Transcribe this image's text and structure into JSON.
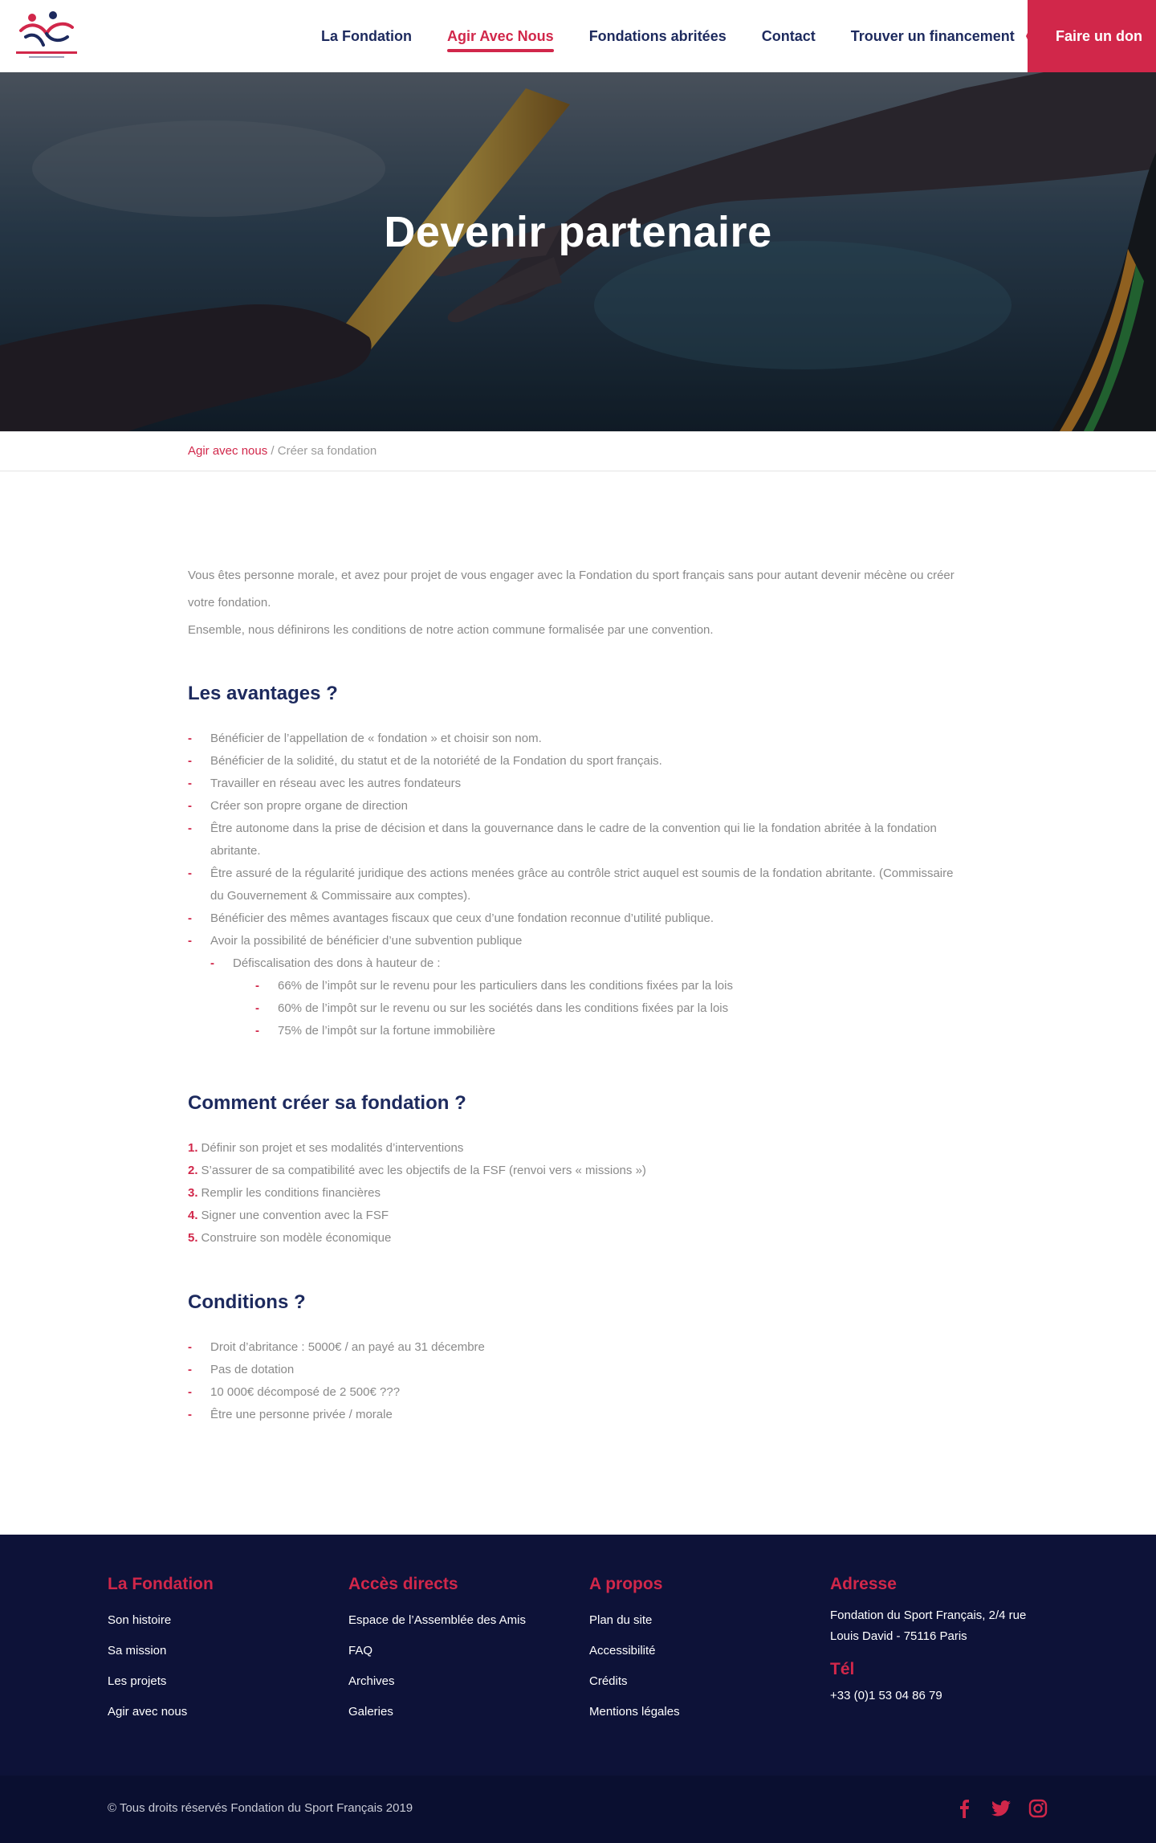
{
  "header": {
    "logo_text": "FONDATION DU SPORT FRANÇAIS",
    "nav": [
      {
        "label": "La Fondation"
      },
      {
        "label": "Agir Avec Nous"
      },
      {
        "label": "Fondations abritées"
      },
      {
        "label": "Contact"
      },
      {
        "label": "Trouver un financement"
      }
    ],
    "donate": "Faire un don"
  },
  "hero": {
    "title": "Devenir partenaire"
  },
  "breadcrumb": {
    "parent": "Agir avec nous",
    "separator": "/",
    "current": "Créer sa fondation"
  },
  "intro": [
    "Vous êtes personne morale, et avez pour projet de vous engager avec la Fondation du sport français sans pour autant devenir mécène ou créer votre fondation.",
    "Ensemble, nous définirons les conditions de notre action commune formalisée par une convention."
  ],
  "avantages": {
    "title": "Les avantages ?",
    "items": [
      "Bénéficier de l’appellation de « fondation » et choisir son nom.",
      "Bénéficier de la solidité, du statut et de la notoriété de la Fondation du sport français.",
      "Travailler en réseau avec les autres fondateurs",
      "Créer son propre organe de direction",
      "Être autonome dans la prise de décision et dans la gouvernance dans le cadre de la convention qui lie la fondation abritée à la fondation abritante.",
      "Être assuré de la régularité juridique des actions menées grâce au contrôle strict auquel est soumis de la fondation abritante. (Commissaire du Gouvernement & Commissaire aux comptes).",
      "Bénéficier des mêmes avantages fiscaux que ceux d’une fondation reconnue d’utilité publique.",
      "Avoir la possibilité de bénéficier d’une subvention publique"
    ],
    "sub": "Défiscalisation des dons à hauteur de :",
    "subsub": [
      "66% de l’impôt sur le revenu pour les particuliers dans les conditions fixées par la lois",
      "60% de l’impôt sur le revenu ou sur les sociétés dans les conditions fixées par la lois",
      "75% de l’impôt sur la fortune immobilière"
    ]
  },
  "creer": {
    "title": "Comment créer sa fondation ?",
    "steps": [
      {
        "num": "1.",
        "text": "Définir son projet et ses modalités d’interventions"
      },
      {
        "num": "2.",
        "text": "S’assurer de sa compatibilité avec les objectifs de la FSF (renvoi vers « missions »)"
      },
      {
        "num": "3.",
        "text": "Remplir les conditions financières"
      },
      {
        "num": "4.",
        "text": "Signer une convention avec la FSF"
      },
      {
        "num": "5.",
        "text": "Construire son modèle économique"
      }
    ]
  },
  "conditions": {
    "title": "Conditions ?",
    "items": [
      "Droit d’abritance : 5000€ / an payé au 31 décembre",
      "Pas de dotation",
      "10 000€ décomposé de 2 500€ ???",
      "Être une personne privée / morale"
    ]
  },
  "footer": {
    "col1": {
      "title": "La Fondation",
      "links": [
        "Son histoire",
        "Sa mission",
        "Les projets",
        "Agir avec nous"
      ]
    },
    "col2": {
      "title": "Accès directs",
      "links": [
        "Espace de l’Assemblée des Amis",
        "FAQ",
        "Archives",
        "Galeries"
      ]
    },
    "col3": {
      "title": "A propos",
      "links": [
        "Plan du site",
        "Accessibilité",
        "Crédits",
        "Mentions légales"
      ]
    },
    "col4": {
      "title": "Adresse",
      "address": "Fondation du Sport Français, 2/4 rue Louis David - 75116 Paris",
      "tel_title": "Tél",
      "tel": "+33 (0)1 53 04 86 79"
    },
    "copyright": "© Tous droits réservés Fondation du Sport Français 2019",
    "social": [
      "facebook-icon",
      "twitter-icon",
      "instagram-icon"
    ]
  },
  "colors": {
    "accent": "#d1274a",
    "navy": "#1d2a5e",
    "footer": "#0d1238"
  }
}
